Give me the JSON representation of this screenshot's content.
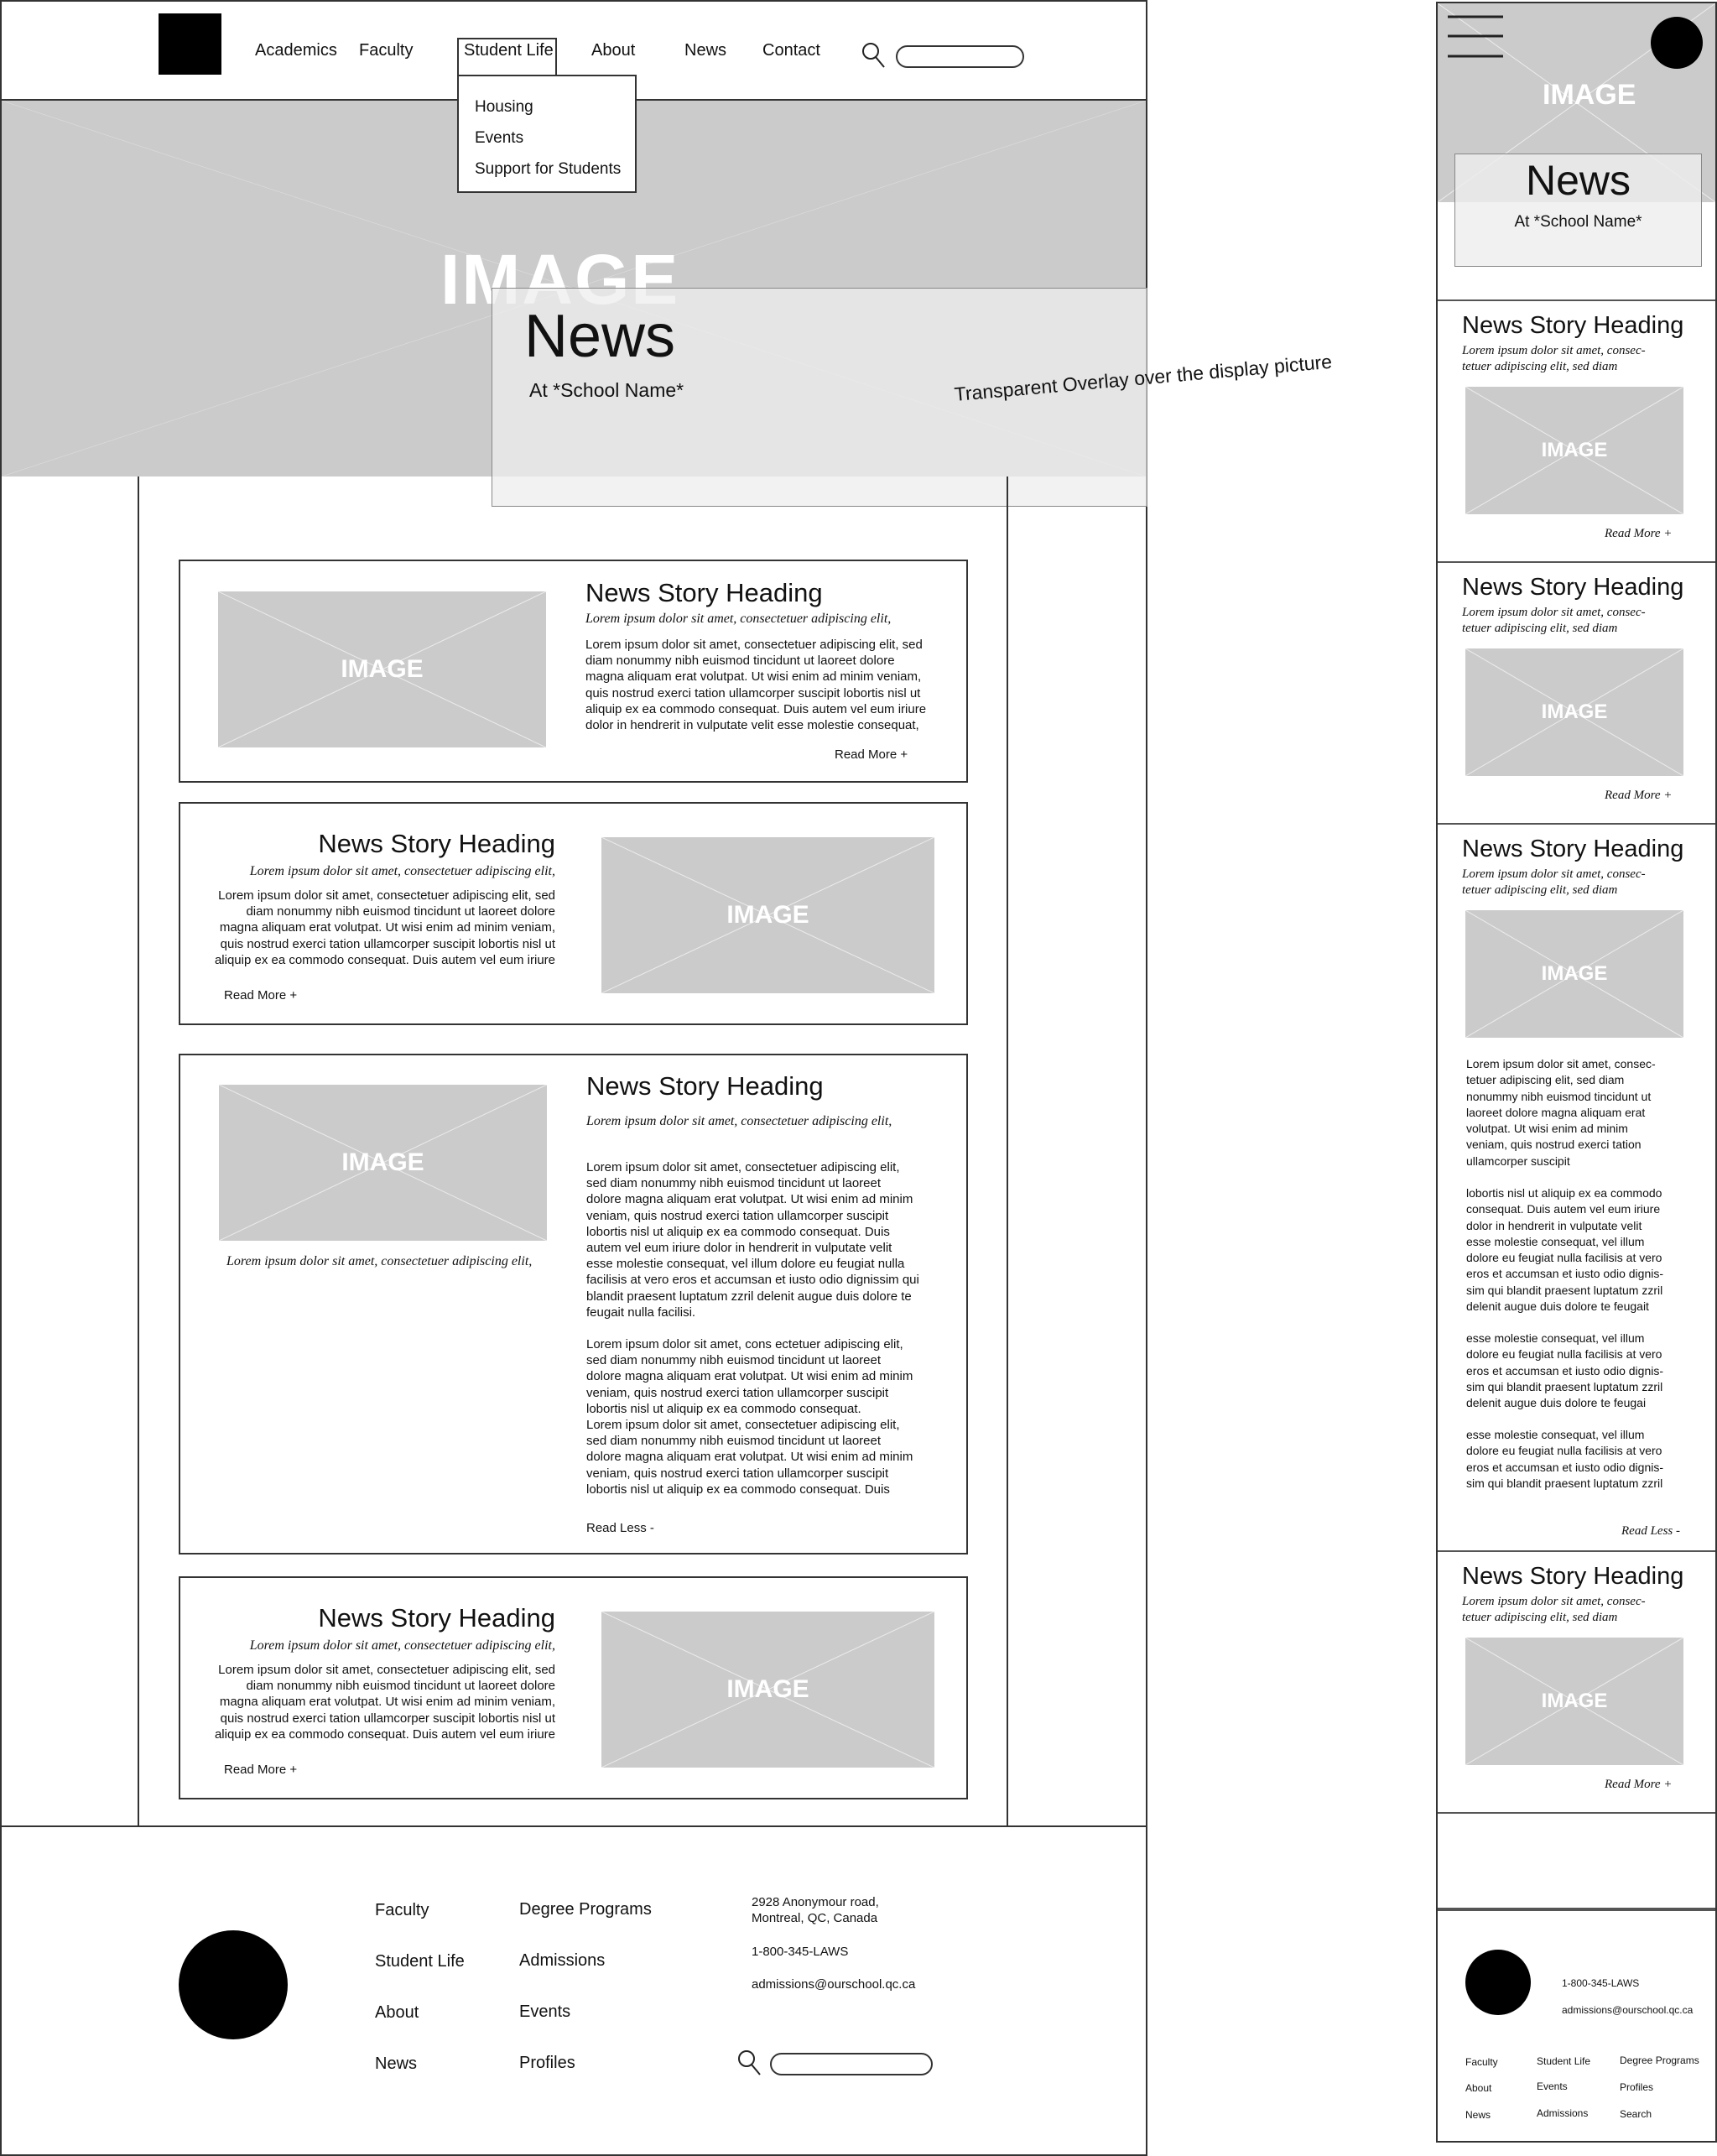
{
  "header": {
    "nav": [
      "Academics",
      "Faculty",
      "Student Life",
      "About",
      "News",
      "Contact"
    ],
    "dropdown": [
      "Housing",
      "Events",
      "Support for Students"
    ]
  },
  "hero": {
    "image_label": "IMAGE",
    "title": "News",
    "subtitle": "At *School Name*",
    "annotation": "Transparent Overlay over the display picture"
  },
  "image_label": "IMAGE",
  "story_heading": "News Story Heading",
  "stories": [
    {
      "heading": "News Story Heading",
      "subheading": "Lorem ipsum dolor sit amet, consectetuer adipiscing elit,",
      "body": [
        "Lorem ipsum dolor sit amet, consectetuer adipiscing elit, sed",
        "diam nonummy nibh euismod tincidunt ut laoreet dolore",
        "magna aliquam erat volutpat. Ut wisi enim ad minim veniam,",
        "quis nostrud exerci tation ullamcorper suscipit lobortis nisl ut",
        "aliquip ex ea commodo consequat. Duis autem vel eum iriure",
        "dolor in hendrerit in vulputate velit esse molestie consequat,"
      ],
      "link": "Read More +"
    },
    {
      "heading": "News Story Heading",
      "subheading": "Lorem ipsum dolor sit amet, consectetuer adipiscing elit,",
      "body": [
        "Lorem ipsum dolor sit amet, consectetuer adipiscing elit, sed",
        "diam nonummy nibh euismod tincidunt ut laoreet dolore",
        "magna aliquam erat volutpat. Ut wisi enim ad minim veniam,",
        "quis nostrud exerci tation ullamcorper suscipit lobortis nisl ut",
        "aliquip ex ea commodo consequat. Duis autem vel eum iriure"
      ],
      "link": "Read More +"
    },
    {
      "heading": "News Story Heading",
      "subheading": "Lorem ipsum dolor sit amet, consectetuer adipiscing elit,",
      "caption": "Lorem ipsum dolor sit amet, consectetuer adipiscing elit,",
      "body1": [
        "Lorem ipsum dolor sit amet, consectetuer adipiscing elit,",
        "sed diam nonummy nibh euismod tincidunt ut laoreet",
        "dolore magna aliquam erat volutpat. Ut wisi enim ad minim",
        "veniam, quis nostrud exerci tation ullamcorper suscipit",
        "lobortis nisl ut aliquip ex ea commodo consequat. Duis",
        "autem vel eum iriure dolor in hendrerit in vulputate velit",
        "esse molestie consequat, vel illum dolore eu feugiat nulla",
        "facilisis at vero eros et accumsan et iusto odio dignissim qui",
        "blandit praesent luptatum zzril delenit augue duis dolore te",
        "feugait nulla facilisi."
      ],
      "body2": [
        "Lorem ipsum dolor sit amet, cons ectetuer adipiscing elit,",
        "sed diam nonummy nibh euismod tincidunt ut laoreet",
        "dolore magna aliquam erat volutpat. Ut wisi enim ad minim",
        "veniam, quis nostrud exerci tation ullamcorper suscipit",
        "lobortis nisl ut aliquip ex ea commodo consequat.",
        "Lorem ipsum dolor sit amet, consectetuer adipiscing elit,",
        "sed diam nonummy nibh euismod tincidunt ut laoreet",
        "dolore magna aliquam erat volutpat. Ut wisi enim ad minim",
        "veniam, quis nostrud exerci tation ullamcorper suscipit",
        "lobortis nisl ut aliquip ex ea commodo consequat. Duis"
      ],
      "link": "Read Less -"
    },
    {
      "heading": "News Story Heading",
      "subheading": "Lorem ipsum dolor sit amet, consectetuer adipiscing elit,",
      "body": [
        "Lorem ipsum dolor sit amet, consectetuer adipiscing elit, sed",
        "diam nonummy nibh euismod tincidunt ut laoreet dolore",
        "magna aliquam erat volutpat. Ut wisi enim ad minim veniam,",
        "quis nostrud exerci tation ullamcorper suscipit lobortis nisl ut",
        "aliquip ex ea commodo consequat. Duis autem vel eum iriure"
      ],
      "link": "Read More +"
    }
  ],
  "footer": {
    "col1": [
      "Faculty",
      "Student Life",
      "About",
      "News"
    ],
    "col2": [
      "Degree Programs",
      "Admissions",
      "Events",
      "Profiles"
    ],
    "address": [
      "2928 Anonymour road,",
      "Montreal, QC, Canada"
    ],
    "phone": "1-800-345-LAWS",
    "email": "admissions@ourschool.qc.ca"
  },
  "mobile": {
    "hero_title": "News",
    "hero_subtitle": "At *School Name*",
    "subheading": [
      "Lorem ipsum dolor sit amet, consec-",
      "tetuer adipiscing elit, sed diam"
    ],
    "read_more": "Read More +",
    "read_less": "Read Less -",
    "expanded_body": [
      [
        "Lorem ipsum dolor sit amet, consec-",
        "tetuer adipiscing elit, sed diam",
        "nonummy nibh euismod tincidunt ut",
        "laoreet dolore magna aliquam erat",
        "volutpat. Ut wisi enim ad minim",
        "veniam, quis nostrud exerci tation",
        "ullamcorper suscipit"
      ],
      [
        "lobortis nisl ut aliquip ex ea commodo",
        "consequat. Duis autem vel eum iriure",
        "dolor in hendrerit in vulputate velit",
        "esse molestie consequat, vel illum",
        "dolore eu feugiat nulla facilisis at vero",
        "eros et accumsan et iusto odio dignis-",
        "sim qui blandit praesent luptatum zzril",
        "delenit augue duis dolore te feugait"
      ],
      [
        "esse molestie consequat, vel illum",
        "dolore eu feugiat nulla facilisis at vero",
        "eros et accumsan et iusto odio dignis-",
        "sim qui blandit praesent luptatum zzril",
        "delenit augue duis dolore te feugai"
      ],
      [
        "esse molestie consequat, vel illum",
        "dolore eu feugiat nulla facilisis at vero",
        "eros et accumsan et iusto odio dignis-",
        "sim qui blandit praesent luptatum zzril"
      ]
    ],
    "footer_phone": "1-800-345-LAWS",
    "footer_email": "admissions@ourschool.qc.ca",
    "footer_links": [
      [
        "Faculty",
        "About",
        "News"
      ],
      [
        "Student Life",
        "Events",
        "Admissions"
      ],
      [
        "Degree Programs",
        "Profiles",
        "Search"
      ]
    ]
  }
}
